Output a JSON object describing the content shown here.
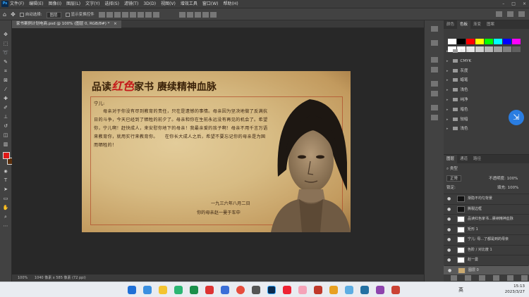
{
  "app": {
    "logo": "Ps"
  },
  "menubar": [
    "文件(F)",
    "编辑(E)",
    "图像(I)",
    "图层(L)",
    "文字(Y)",
    "选择(S)",
    "滤镜(T)",
    "3D(D)",
    "视图(V)",
    "增效工具",
    "窗口(W)",
    "帮助(H)"
  ],
  "window_controls": [
    "–",
    "□",
    "×"
  ],
  "options": {
    "auto_select": "自动选择:",
    "auto_select_value": "图层",
    "show_transform": "显示变换控件"
  },
  "document": {
    "tab": "家书案例计划电商.psd @ 100% (图层 0, RGB/8#) *",
    "title_pre": "品读",
    "title_red": "红色",
    "title_post": "家书 赓续精神血脉",
    "salutation": "宁儿:",
    "body": "　　母亲对于你没有尽到教育的责任，只在是遗憾的事情。母亲因为坚决地做了反满抗日的斗争，今天已经到了牺牲的前夕了。母亲和你在生前永远没有再见的机会了。希望你，宁儿啊！赶快成人，来安慰你地下的母亲！我最亲爱的孩子啊！母亲不用千言万语来教育你，就用实行来教育你。　　在你长大成人之后，希望不要忘记你的母亲是为国而牺牲的！",
    "date": "一九三六年八月二日",
    "signature": "你的母亲赵一曼于车中"
  },
  "status": {
    "zoom": "100%",
    "size": "1040 像素 x 585 像素 (72 ppi)"
  },
  "swatches": {
    "tabs": [
      "颜色",
      "色板",
      "渐变",
      "图案"
    ],
    "active_tab": 1,
    "row1": [
      "#ffffff",
      "#000000",
      "#ff0000",
      "#ffff00",
      "#00ff00",
      "#00ffff",
      "#0000ff",
      "#ff00ff"
    ],
    "row2": [
      "#ffffff",
      "#ffffff",
      "#e8e8e8",
      "#d0d0d0",
      "#b8b8b8",
      "#a0a0a0",
      "#808080",
      "#606060"
    ],
    "groups": [
      "RGB",
      "CMYK",
      "灰度",
      "蜡笔",
      "浅色",
      "纯净",
      "暗色",
      "较暗",
      "浅色"
    ]
  },
  "layers": {
    "tabs": [
      "图层",
      "通道",
      "路径"
    ],
    "kind": "类型",
    "blend": "正常",
    "opacity_label": "不透明度:",
    "opacity": "100%",
    "lock_label": "锁定:",
    "fill_label": "填充:",
    "fill": "100%",
    "items": [
      "渐隐不均匀背景",
      "撕裂边框",
      "品读红色家书...赓续精神血脉",
      "矩形 1",
      "宁儿: 母...了都是到的母亲",
      "色阶 / 对比度 1",
      "赵一曼",
      "图层 0"
    ],
    "selected": 7
  },
  "taskbar": {
    "lang": "英",
    "time": "15:13",
    "date": "2023/3/27"
  },
  "colors": {
    "foreground": "#e01818",
    "background": "#5a2e0c",
    "accent": "#2a7de1"
  }
}
